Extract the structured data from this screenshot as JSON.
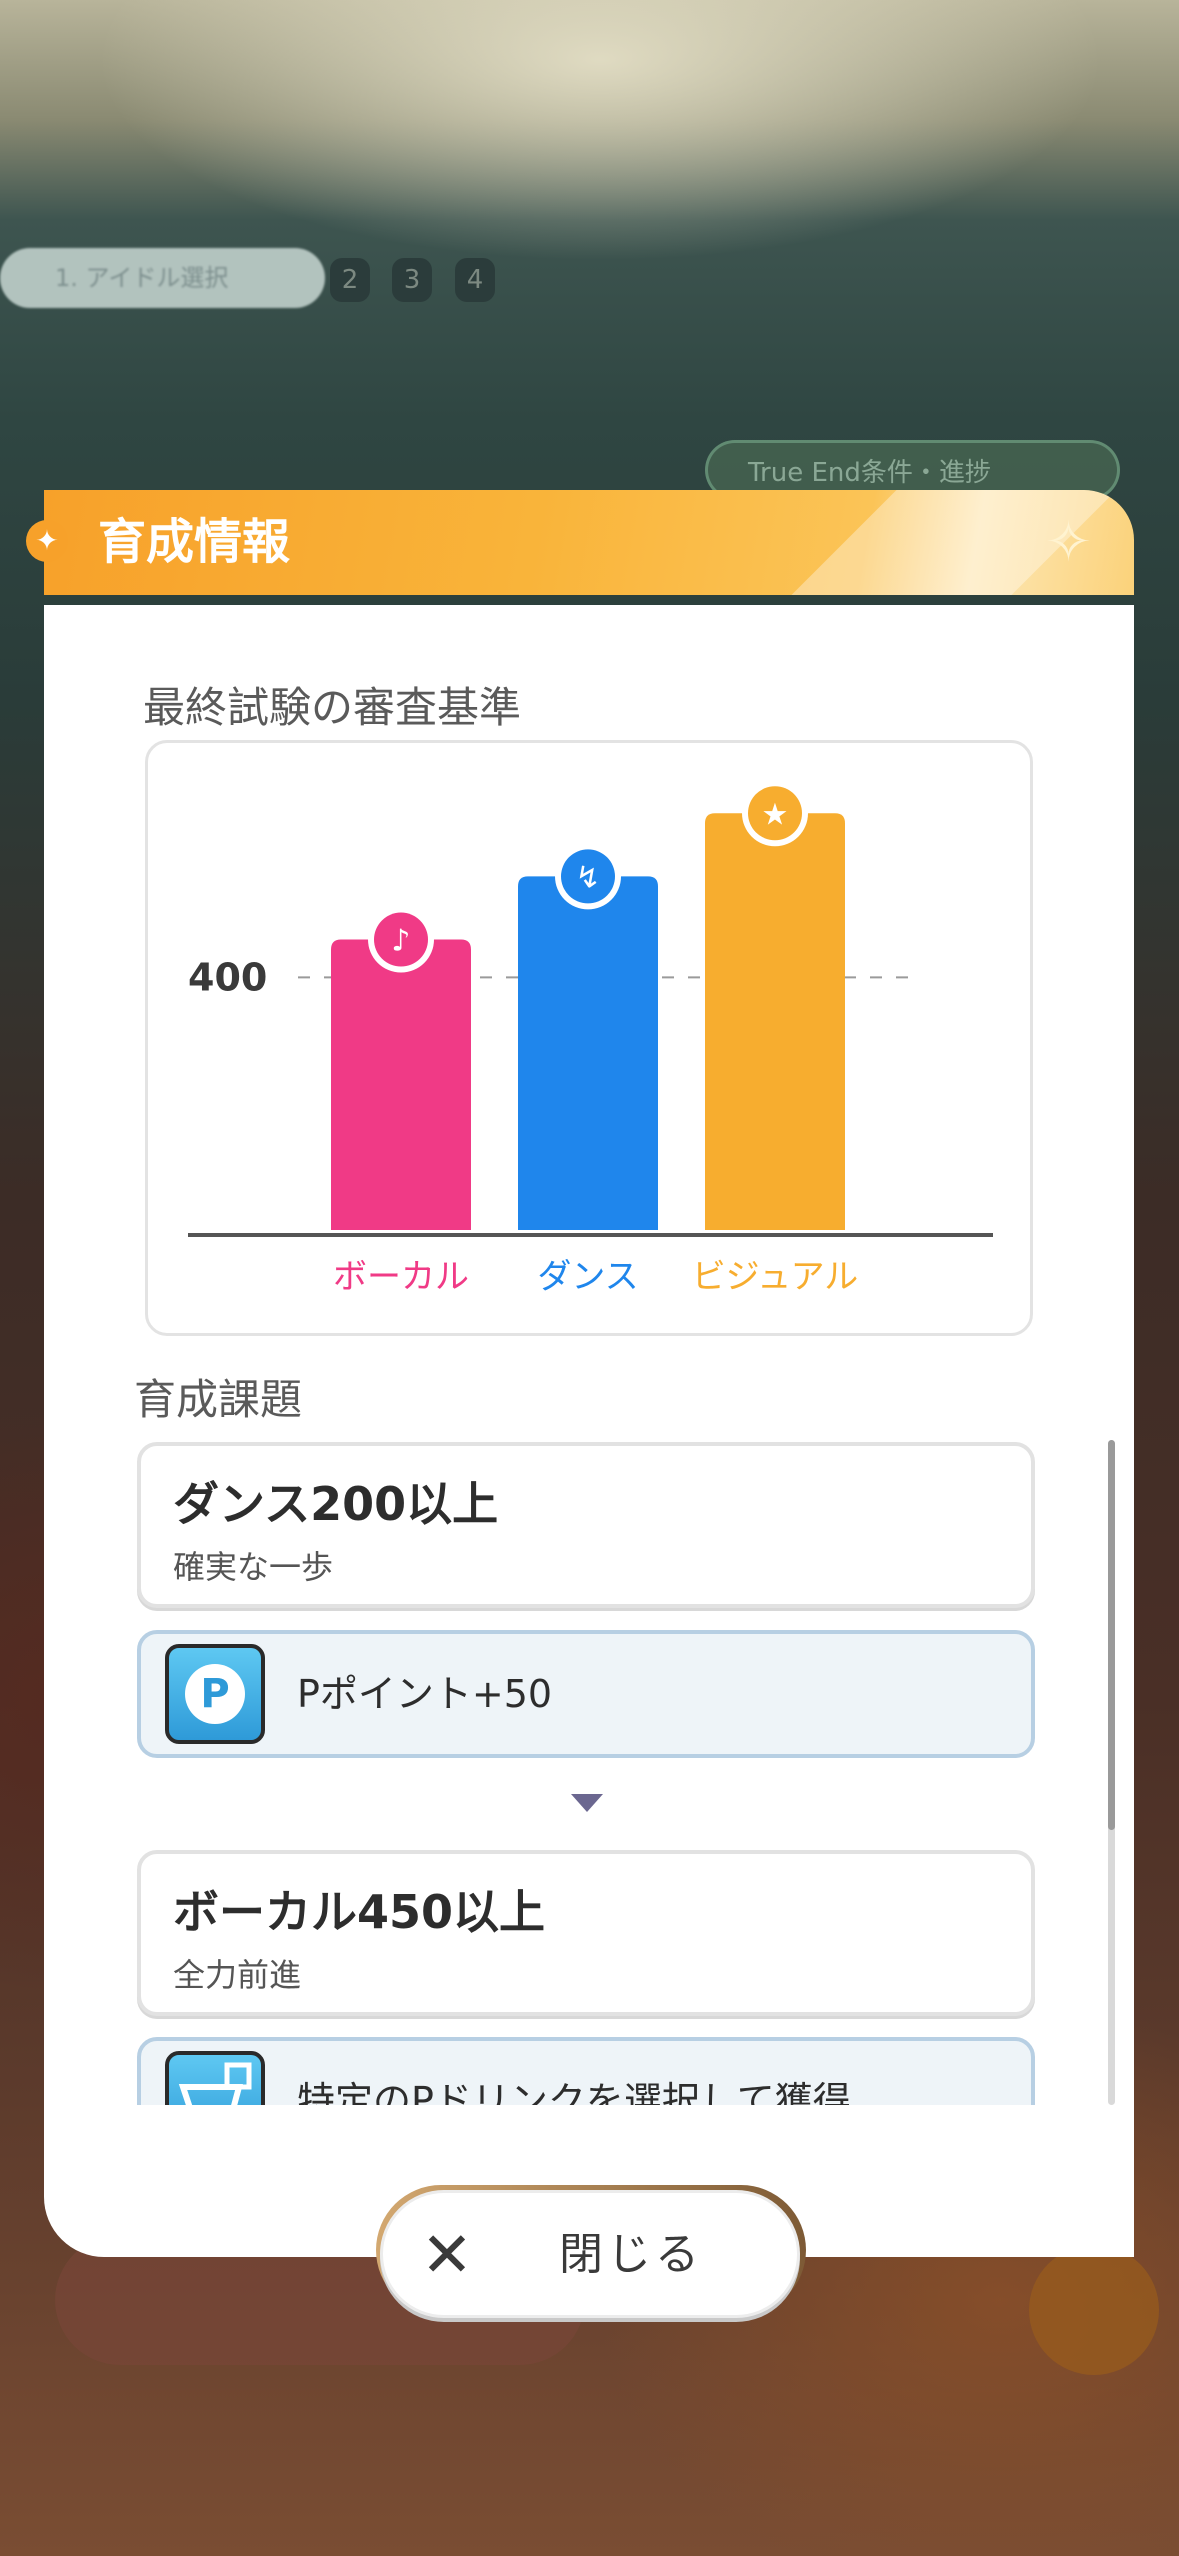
{
  "header": {
    "title": "育成情報"
  },
  "criteria": {
    "section_title": "最終試験の審査基準",
    "chart_data": {
      "type": "bar",
      "categories": [
        "ボーカル",
        "ダンス",
        "ビジュアル"
      ],
      "values": [
        460,
        560,
        660
      ],
      "reference_line": {
        "value": 400,
        "label": "400"
      },
      "colors": [
        "#f03a86",
        "#1f86ec",
        "#f7ad2f"
      ],
      "icons": [
        "microphone-icon",
        "shoe-icon",
        "star-face-icon"
      ],
      "ylim": [
        0,
        700
      ],
      "grid": false
    }
  },
  "tasks": {
    "section_title": "育成課題",
    "items": [
      {
        "title": "ダンス200以上",
        "subtitle": "確実な一歩",
        "reward": "Pポイント+50",
        "reward_icon": "p-point-icon"
      },
      {
        "title": "ボーカル450以上",
        "subtitle": "全力前進",
        "reward": "特定のPドリンクを選択して獲得",
        "reward_icon": "shopping-cart-icon"
      }
    ]
  },
  "close_button": {
    "label": "閉じる"
  },
  "background": {
    "pill_text": "1. アイドル選択",
    "steps": [
      "2",
      "3",
      "4"
    ],
    "true_end_text": "True End条件・進捗"
  }
}
